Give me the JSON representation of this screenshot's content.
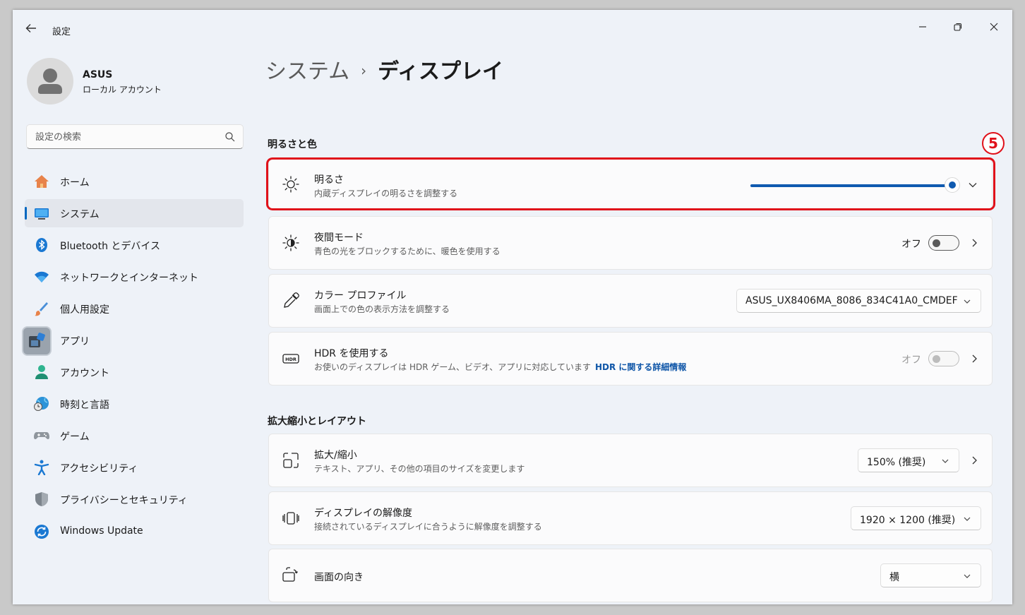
{
  "window": {
    "app_title": "設定"
  },
  "profile": {
    "name": "ASUS",
    "account_type": "ローカル アカウント"
  },
  "search": {
    "placeholder": "設定の検索"
  },
  "sidebar": {
    "items": [
      {
        "label": "ホーム",
        "icon": "home-icon"
      },
      {
        "label": "システム",
        "icon": "system-icon",
        "active": true
      },
      {
        "label": "Bluetooth とデバイス",
        "icon": "bluetooth-icon"
      },
      {
        "label": "ネットワークとインターネット",
        "icon": "wifi-icon"
      },
      {
        "label": "個人用設定",
        "icon": "brush-icon"
      },
      {
        "label": "アプリ",
        "icon": "apps-icon"
      },
      {
        "label": "アカウント",
        "icon": "account-icon"
      },
      {
        "label": "時刻と言語",
        "icon": "globe-clock-icon"
      },
      {
        "label": "ゲーム",
        "icon": "gamepad-icon"
      },
      {
        "label": "アクセシビリティ",
        "icon": "accessibility-icon"
      },
      {
        "label": "プライバシーとセキュリティ",
        "icon": "shield-icon"
      },
      {
        "label": "Windows Update",
        "icon": "update-icon"
      }
    ]
  },
  "breadcrumb": {
    "parent": "システム",
    "separator": "›",
    "current": "ディスプレイ"
  },
  "sections": {
    "brightness_color": "明るさと色",
    "scale_layout": "拡大縮小とレイアウト"
  },
  "settings": {
    "brightness": {
      "title": "明るさ",
      "description": "内蔵ディスプレイの明るさを調整する",
      "value_fraction": 1.0
    },
    "night_light": {
      "title": "夜間モード",
      "description": "青色の光をブロックするために、暖色を使用する",
      "toggle_label": "オフ",
      "enabled": false
    },
    "color_profile": {
      "title": "カラー プロファイル",
      "description": "画面上での色の表示方法を調整する",
      "value": "ASUS_UX8406MA_8086_834C41A0_CMDEF"
    },
    "hdr": {
      "title": "HDR を使用する",
      "description": "お使いのディスプレイは HDR ゲーム、ビデオ、アプリに対応しています",
      "link": "HDR に関する詳細情報",
      "toggle_label": "オフ",
      "enabled": false,
      "disabled": true
    },
    "scale": {
      "title": "拡大/縮小",
      "description": "テキスト、アプリ、その他の項目のサイズを変更します",
      "value": "150% (推奨)"
    },
    "resolution": {
      "title": "ディスプレイの解像度",
      "description": "接続されているディスプレイに合うように解像度を調整する",
      "value": "1920 × 1200 (推奨)"
    },
    "orientation": {
      "title": "画面の向き",
      "value": "横"
    }
  },
  "annotation": {
    "step": "5"
  },
  "colors": {
    "accent": "#0f5ab0",
    "highlight": "#e0111a"
  }
}
